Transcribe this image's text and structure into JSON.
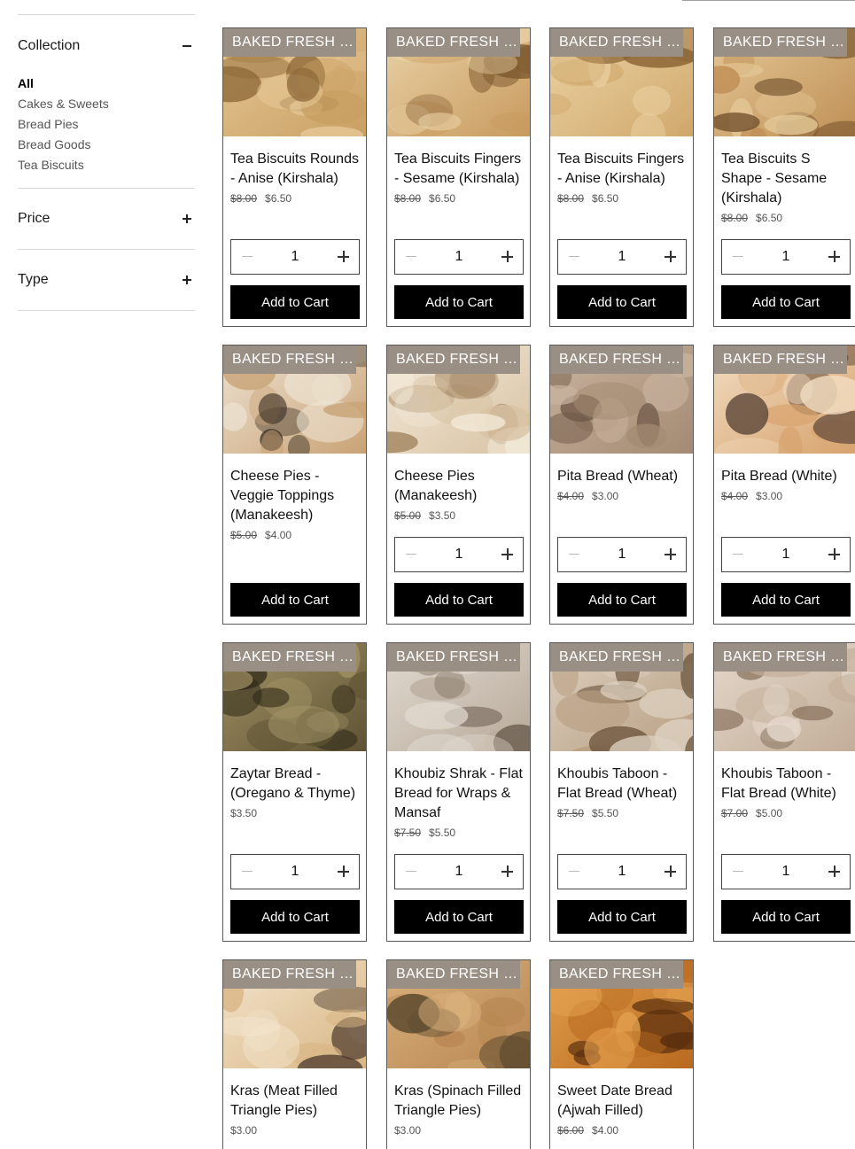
{
  "sidebar": {
    "collection": {
      "title": "Collection",
      "items": [
        "All",
        "Cakes & Sweets",
        "Bread Pies",
        "Bread Goods",
        "Tea Biscuits"
      ],
      "active": "All"
    },
    "price": {
      "title": "Price"
    },
    "type": {
      "title": "Type"
    }
  },
  "ribbon": "BAKED FRESH DAILY",
  "cart_label": "Add to Cart",
  "products": [
    {
      "name": "Tea Biscuits Rounds - Anise (Kirshala)",
      "old_price": "$8.00",
      "price": "$6.50",
      "qty": "1",
      "image": "tea-biscuits-rounds",
      "tones": [
        "#c9a063",
        "#e6c796",
        "#8f6a3a"
      ]
    },
    {
      "name": "Tea Biscuits Fingers - Sesame (Kirshala)",
      "old_price": "$8.00",
      "price": "$6.50",
      "qty": "1",
      "image": "tea-biscuits-fingers-sesame",
      "tones": [
        "#c89a5e",
        "#e9d2a6",
        "#7f5a30"
      ]
    },
    {
      "name": "Tea Biscuits Fingers - Anise (Kirshala)",
      "old_price": "$8.00",
      "price": "$6.50",
      "qty": "1",
      "image": "tea-biscuits-fingers-anise",
      "tones": [
        "#d0a86c",
        "#ecd3a4",
        "#8a6434"
      ]
    },
    {
      "name": "Tea Biscuits S Shape - Sesame (Kirshala)",
      "old_price": "$8.00",
      "price": "$6.50",
      "qty": "1",
      "image": "tea-biscuits-s-shape",
      "tones": [
        "#bf8f55",
        "#e4c897",
        "#6f4e2a"
      ]
    },
    {
      "name": "Cheese Pies - Veggie Toppings (Manakeesh)",
      "old_price": "$5.00",
      "price": "$4.00",
      "qty": "",
      "image": "cheese-pies-veggie",
      "tones": [
        "#c9a275",
        "#ede3d2",
        "#3b3024"
      ]
    },
    {
      "name": "Cheese Pies (Manakeesh)",
      "old_price": "$5.00",
      "price": "$3.50",
      "qty": "1",
      "image": "cheese-pies",
      "tones": [
        "#d8c2a3",
        "#f3ead9",
        "#9a7a55"
      ]
    },
    {
      "name": "Pita Bread (Wheat)",
      "old_price": "$4.00",
      "price": "$3.00",
      "qty": "1",
      "image": "pita-bread-wheat",
      "tones": [
        "#a48a73",
        "#c8b39e",
        "#6d5746"
      ]
    },
    {
      "name": "Pita Bread (White)",
      "old_price": "$4.00",
      "price": "$3.00",
      "qty": "1",
      "image": "pita-bread-white",
      "tones": [
        "#d7a26c",
        "#f1dcc2",
        "#5a4436"
      ]
    },
    {
      "name": "Zaytar Bread - (Oregano & Thyme)",
      "old_price": "",
      "price": "$3.50",
      "qty": "1",
      "image": "zaytar-bread",
      "tones": [
        "#5d5233",
        "#a39467",
        "#2c2716"
      ]
    },
    {
      "name": "Khoubiz Shrak - Flat Bread for Wraps & Mansaf",
      "old_price": "$7.50",
      "price": "$5.50",
      "qty": "1",
      "image": "khoubiz-shrak",
      "tones": [
        "#b6a999",
        "#e2dad0",
        "#6f6152"
      ]
    },
    {
      "name": "Khoubis Taboon - Flat Bread (Wheat)",
      "old_price": "$7.50",
      "price": "$5.50",
      "qty": "1",
      "image": "khoubis-taboon-wheat",
      "tones": [
        "#b89f82",
        "#ddd0c0",
        "#6a523a"
      ]
    },
    {
      "name": "Khoubis Taboon - Flat Bread (White)",
      "old_price": "$7.00",
      "price": "$5.00",
      "qty": "1",
      "image": "khoubis-taboon-white",
      "tones": [
        "#c2ad98",
        "#e4d7ca",
        "#7c6550"
      ]
    },
    {
      "name": "Kras (Meat Filled Triangle Pies)",
      "old_price": "",
      "price": "$3.00",
      "qty": "",
      "image": "kras-meat",
      "tones": [
        "#d9b684",
        "#f2e4cc",
        "#4c3a2c"
      ]
    },
    {
      "name": "Kras (Spinach Filled Triangle Pies)",
      "old_price": "",
      "price": "$3.00",
      "qty": "",
      "image": "kras-spinach",
      "tones": [
        "#b88752",
        "#d9b07c",
        "#5c4a2e"
      ]
    },
    {
      "name": "Sweet Date Bread (Ajwah Filled)",
      "old_price": "$6.00",
      "price": "$4.00",
      "qty": "",
      "image": "sweet-date-bread",
      "tones": [
        "#b86a1f",
        "#e3a04e",
        "#5a2f0e"
      ]
    }
  ]
}
